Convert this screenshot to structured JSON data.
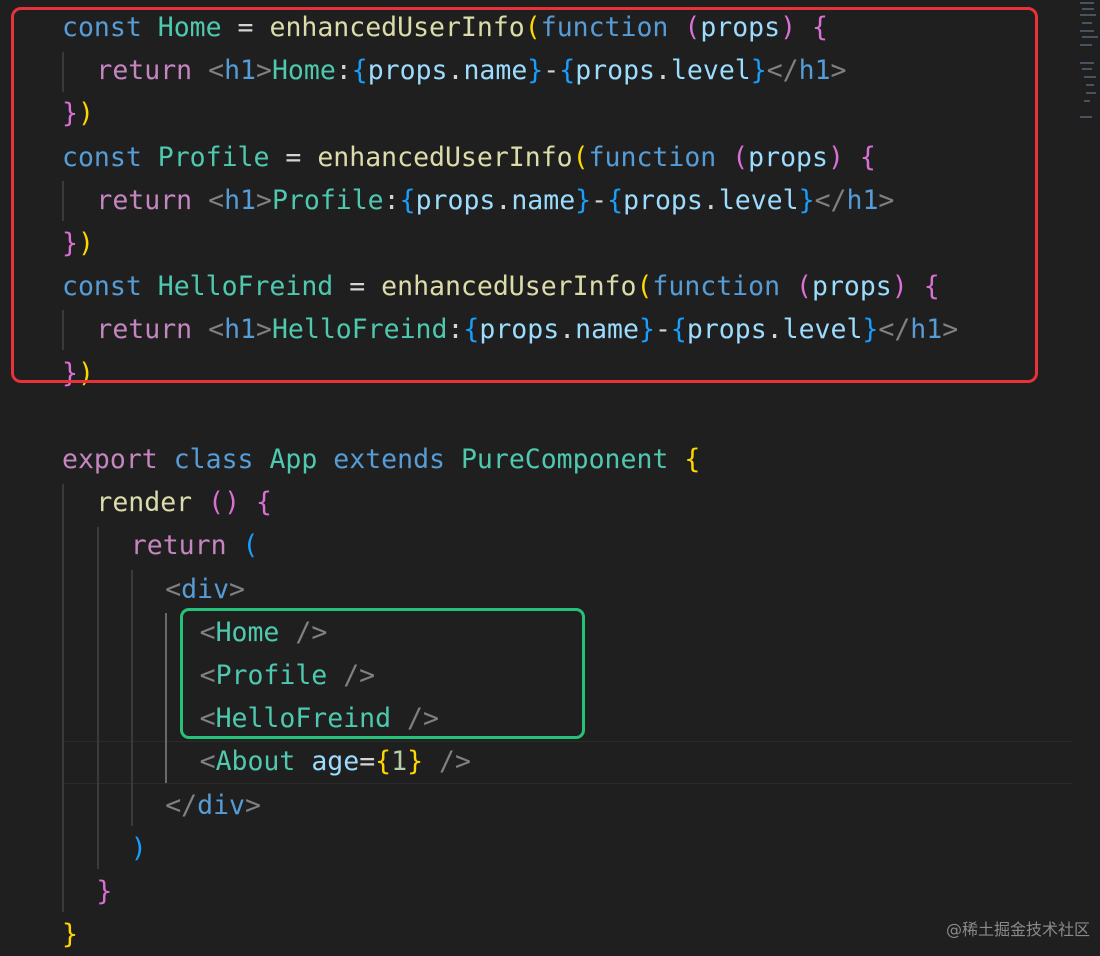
{
  "code": {
    "lines": [
      "const Home = enhancedUserInfo(function (props) {",
      "  return <h1>Home:{props.name}-{props.level}</h1>",
      "})",
      "const Profile = enhancedUserInfo(function (props) {",
      "  return <h1>Profile:{props.name}-{props.level}</h1>",
      "})",
      "const HelloFreind = enhancedUserInfo(function (props) {",
      "  return <h1>HelloFreind:{props.name}-{props.level}</h1>",
      "})",
      "",
      "export class App extends PureComponent {",
      "  render () {",
      "    return (",
      "      <div>",
      "        <Home />",
      "        <Profile />",
      "        <HelloFreind />",
      "        <About age={1} />",
      "      </div>",
      "    )",
      "  }",
      "}"
    ]
  },
  "highlights": {
    "red_color": "#e8323a",
    "green_color": "#27c27a"
  },
  "watermark": "@稀土掘金技术社区"
}
